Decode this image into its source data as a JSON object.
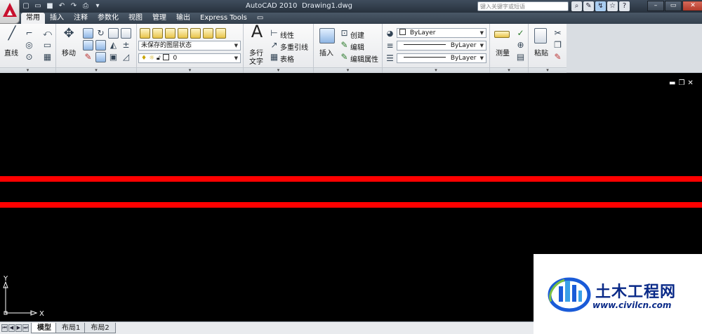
{
  "titlebar": {
    "app_title": "AutoCAD 2010",
    "file_title": "Drawing1.dwg",
    "search_placeholder": "键入关键字或短语",
    "qat": [
      "new-icon",
      "open-icon",
      "save-icon",
      "undo-icon",
      "redo-icon",
      "plot-icon",
      "dropdown-icon"
    ],
    "win_min": "–",
    "win_max": "▭",
    "win_close": "✕"
  },
  "tabs": [
    {
      "label": "常用",
      "active": true
    },
    {
      "label": "插入"
    },
    {
      "label": "注释"
    },
    {
      "label": "参数化"
    },
    {
      "label": "视图"
    },
    {
      "label": "管理"
    },
    {
      "label": "输出"
    },
    {
      "label": "Express Tools"
    },
    {
      "label": "▭"
    }
  ],
  "ribbon": {
    "draw": {
      "line_label": "直线"
    },
    "modify": {
      "move_label": "移动"
    },
    "layers": {
      "state_value": "未保存的图层状态",
      "layer_value": "0"
    },
    "annotation": {
      "mtext_label": "多行",
      "mtext_label2": "文字",
      "linear": "线性",
      "mleader": "多重引线",
      "table": "表格"
    },
    "block": {
      "insert_label": "插入",
      "create": "创建",
      "edit": "编辑",
      "edit_attr": "编辑属性"
    },
    "properties": {
      "color": "ByLayer",
      "lineweight": "ByLayer",
      "linetype": "ByLayer"
    },
    "utilities": {
      "measure_label": "测量"
    },
    "clipboard": {
      "paste_label": "粘贴"
    }
  },
  "drawing": {
    "background": "#000000",
    "line_color": "#ff0000",
    "ucs_x": "X",
    "ucs_y": "Y"
  },
  "layout_tabs": [
    {
      "label": "模型",
      "active": true
    },
    {
      "label": "布局1"
    },
    {
      "label": "布局2"
    }
  ],
  "watermark": {
    "name": "土木工程网",
    "url": "www.civilcn.com"
  }
}
